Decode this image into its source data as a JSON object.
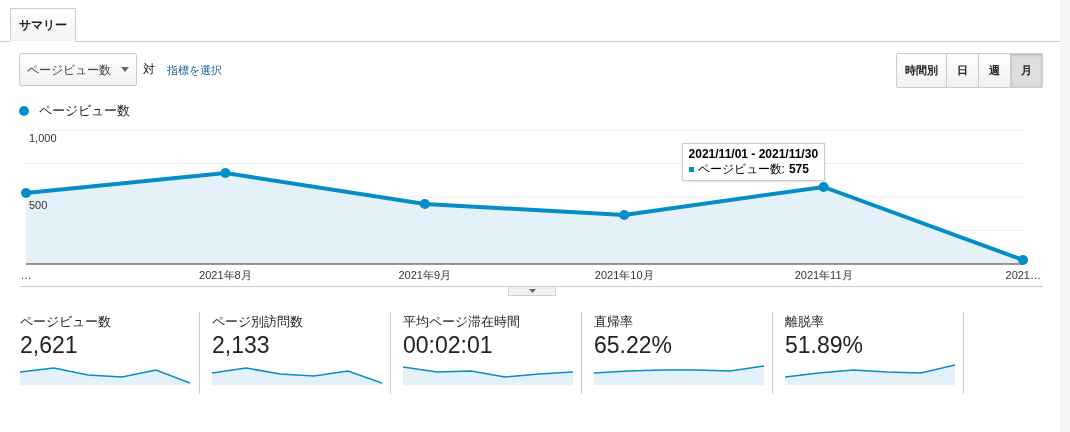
{
  "tabs": [
    {
      "label": "サマリー",
      "selected": true
    }
  ],
  "metric_select": {
    "value": "ページビュー数"
  },
  "versus": "対",
  "select_metric_link": "指標を選択",
  "granularity": [
    {
      "label": "時間別",
      "selected": false
    },
    {
      "label": "日",
      "selected": false
    },
    {
      "label": "週",
      "selected": false
    },
    {
      "label": "月",
      "selected": true
    }
  ],
  "legend": {
    "color": "#058dc7"
  },
  "chart": {
    "chart_data": {
      "type": "area",
      "categories": [
        "…",
        "2021年8月",
        "2021年9月",
        "2021年10月",
        "2021年11月",
        "2021…"
      ],
      "series": [
        {
          "name": "ページビュー数",
          "color": "#058dc7",
          "values": [
            530,
            679,
            448,
            366,
            575,
            30
          ]
        }
      ],
      "ylim": [
        0,
        1000
      ],
      "yticks": [
        {
          "value": 500,
          "label": "500"
        },
        {
          "value": 1000,
          "label": "1,000"
        }
      ]
    },
    "tooltip": {
      "title": "2021/11/01 - 2021/11/30",
      "label": "ページビュー数:",
      "value": "575"
    }
  },
  "metrics": [
    {
      "label": "ページビュー数",
      "value": "2,621"
    },
    {
      "label": "ページ別訪問数",
      "value": "2,133"
    },
    {
      "label": "平均ページ滞在時間",
      "value": "00:02:01"
    },
    {
      "label": "直帰率",
      "value": "65.22%"
    },
    {
      "label": "離脱率",
      "value": "51.89%"
    }
  ]
}
